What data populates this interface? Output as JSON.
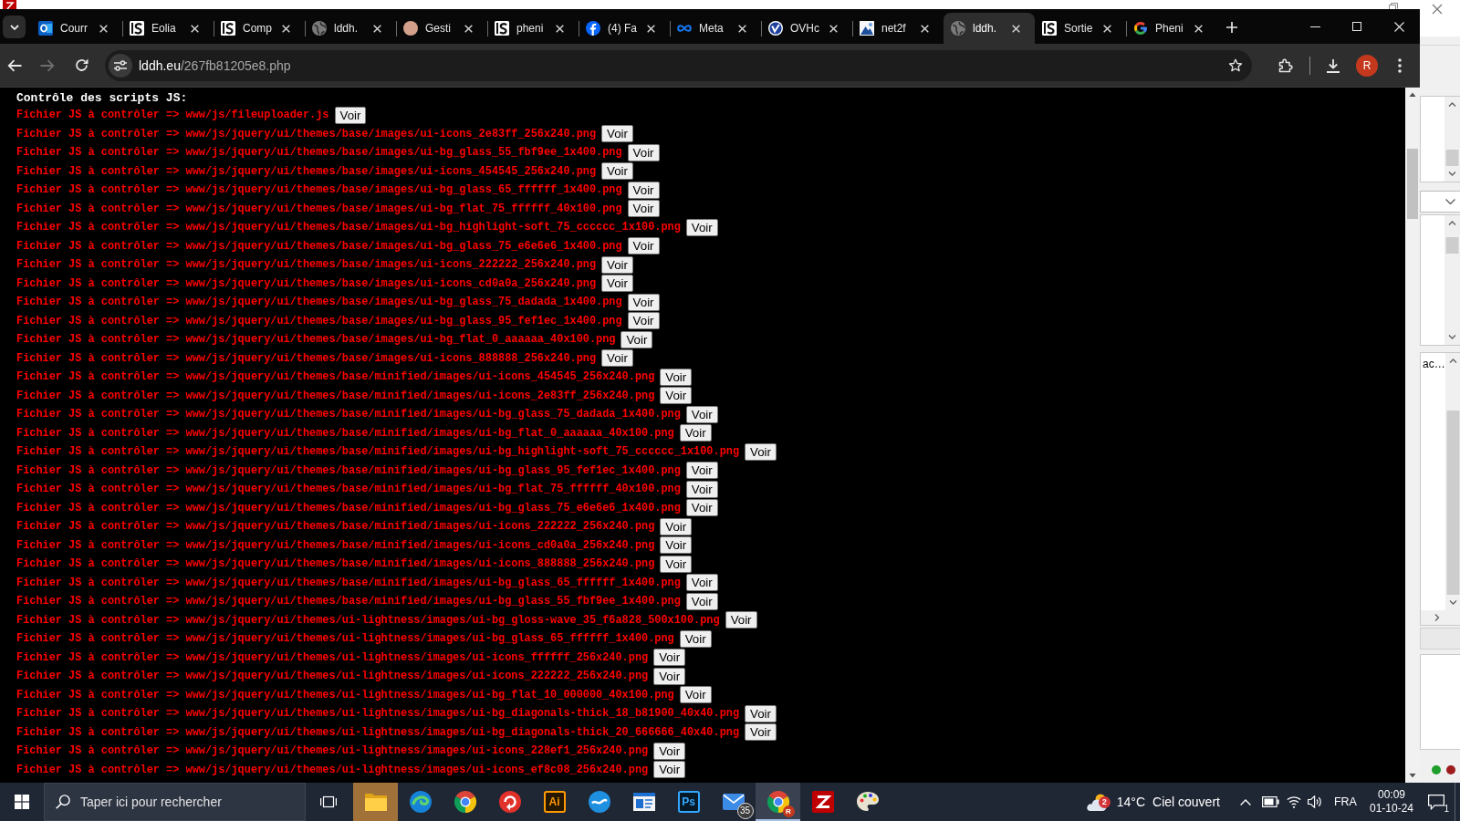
{
  "background_window": {
    "panel_text": "ac…",
    "status_lights": [
      {
        "color": "#1e9e2a"
      },
      {
        "color": "#9e1b1b"
      }
    ]
  },
  "browser": {
    "tabs": [
      {
        "title": "Courr",
        "kind": "mail",
        "selected": false
      },
      {
        "title": "Eolia",
        "kind": "logo",
        "selected": false
      },
      {
        "title": "Comp",
        "kind": "logo",
        "selected": false
      },
      {
        "title": "lddh.",
        "kind": "globe",
        "selected": false
      },
      {
        "title": "Gesti",
        "kind": "avatar",
        "selected": false
      },
      {
        "title": "pheni",
        "kind": "logo",
        "selected": false
      },
      {
        "title": "(4) Fa",
        "kind": "social",
        "selected": false
      },
      {
        "title": "Meta",
        "kind": "infinity",
        "selected": false
      },
      {
        "title": "OVHc",
        "kind": "check",
        "selected": false
      },
      {
        "title": "net2f",
        "kind": "picture",
        "selected": false
      },
      {
        "title": "lddh.",
        "kind": "globe",
        "selected": true
      },
      {
        "title": "Sortie",
        "kind": "logo",
        "selected": false
      },
      {
        "title": "Pheni",
        "kind": "ring",
        "selected": false
      }
    ],
    "navigation": {
      "back": {
        "disabled": false
      },
      "forward": {
        "disabled": true
      }
    },
    "address_bar": {
      "host": "lddh.eu",
      "path": "/267fb81205e8.php"
    },
    "profile_initial": "R",
    "page": {
      "heading": "Contrôle des scripts JS:",
      "rows": [
        {
          "text": "Fichier JS à contrôler => www/js/fileuploader.js",
          "button": "Voir"
        },
        {
          "text": "Fichier JS à contrôler => www/js/jquery/ui/themes/base/images/ui-icons_2e83ff_256x240.png",
          "button": "Voir"
        },
        {
          "text": "Fichier JS à contrôler => www/js/jquery/ui/themes/base/images/ui-bg_glass_55_fbf9ee_1x400.png",
          "button": "Voir"
        },
        {
          "text": "Fichier JS à contrôler => www/js/jquery/ui/themes/base/images/ui-icons_454545_256x240.png",
          "button": "Voir"
        },
        {
          "text": "Fichier JS à contrôler => www/js/jquery/ui/themes/base/images/ui-bg_glass_65_ffffff_1x400.png",
          "button": "Voir"
        },
        {
          "text": "Fichier JS à contrôler => www/js/jquery/ui/themes/base/images/ui-bg_flat_75_ffffff_40x100.png",
          "button": "Voir"
        },
        {
          "text": "Fichier JS à contrôler => www/js/jquery/ui/themes/base/images/ui-bg_highlight-soft_75_cccccc_1x100.png",
          "button": "Voir"
        },
        {
          "text": "Fichier JS à contrôler => www/js/jquery/ui/themes/base/images/ui-bg_glass_75_e6e6e6_1x400.png",
          "button": "Voir"
        },
        {
          "text": "Fichier JS à contrôler => www/js/jquery/ui/themes/base/images/ui-icons_222222_256x240.png",
          "button": "Voir"
        },
        {
          "text": "Fichier JS à contrôler => www/js/jquery/ui/themes/base/images/ui-icons_cd0a0a_256x240.png",
          "button": "Voir"
        },
        {
          "text": "Fichier JS à contrôler => www/js/jquery/ui/themes/base/images/ui-bg_glass_75_dadada_1x400.png",
          "button": "Voir"
        },
        {
          "text": "Fichier JS à contrôler => www/js/jquery/ui/themes/base/images/ui-bg_glass_95_fef1ec_1x400.png",
          "button": "Voir"
        },
        {
          "text": "Fichier JS à contrôler => www/js/jquery/ui/themes/base/images/ui-bg_flat_0_aaaaaa_40x100.png",
          "button": "Voir"
        },
        {
          "text": "Fichier JS à contrôler => www/js/jquery/ui/themes/base/images/ui-icons_888888_256x240.png",
          "button": "Voir"
        },
        {
          "text": "Fichier JS à contrôler => www/js/jquery/ui/themes/base/minified/images/ui-icons_454545_256x240.png",
          "button": "Voir"
        },
        {
          "text": "Fichier JS à contrôler => www/js/jquery/ui/themes/base/minified/images/ui-icons_2e83ff_256x240.png",
          "button": "Voir"
        },
        {
          "text": "Fichier JS à contrôler => www/js/jquery/ui/themes/base/minified/images/ui-bg_glass_75_dadada_1x400.png",
          "button": "Voir"
        },
        {
          "text": "Fichier JS à contrôler => www/js/jquery/ui/themes/base/minified/images/ui-bg_flat_0_aaaaaa_40x100.png",
          "button": "Voir"
        },
        {
          "text": "Fichier JS à contrôler => www/js/jquery/ui/themes/base/minified/images/ui-bg_highlight-soft_75_cccccc_1x100.png",
          "button": "Voir"
        },
        {
          "text": "Fichier JS à contrôler => www/js/jquery/ui/themes/base/minified/images/ui-bg_glass_95_fef1ec_1x400.png",
          "button": "Voir"
        },
        {
          "text": "Fichier JS à contrôler => www/js/jquery/ui/themes/base/minified/images/ui-bg_flat_75_ffffff_40x100.png",
          "button": "Voir"
        },
        {
          "text": "Fichier JS à contrôler => www/js/jquery/ui/themes/base/minified/images/ui-bg_glass_75_e6e6e6_1x400.png",
          "button": "Voir"
        },
        {
          "text": "Fichier JS à contrôler => www/js/jquery/ui/themes/base/minified/images/ui-icons_222222_256x240.png",
          "button": "Voir"
        },
        {
          "text": "Fichier JS à contrôler => www/js/jquery/ui/themes/base/minified/images/ui-icons_cd0a0a_256x240.png",
          "button": "Voir"
        },
        {
          "text": "Fichier JS à contrôler => www/js/jquery/ui/themes/base/minified/images/ui-icons_888888_256x240.png",
          "button": "Voir"
        },
        {
          "text": "Fichier JS à contrôler => www/js/jquery/ui/themes/base/minified/images/ui-bg_glass_65_ffffff_1x400.png",
          "button": "Voir"
        },
        {
          "text": "Fichier JS à contrôler => www/js/jquery/ui/themes/base/minified/images/ui-bg_glass_55_fbf9ee_1x400.png",
          "button": "Voir"
        },
        {
          "text": "Fichier JS à contrôler => www/js/jquery/ui/themes/ui-lightness/images/ui-bg_gloss-wave_35_f6a828_500x100.png",
          "button": "Voir"
        },
        {
          "text": "Fichier JS à contrôler => www/js/jquery/ui/themes/ui-lightness/images/ui-bg_glass_65_ffffff_1x400.png",
          "button": "Voir"
        },
        {
          "text": "Fichier JS à contrôler => www/js/jquery/ui/themes/ui-lightness/images/ui-icons_ffffff_256x240.png",
          "button": "Voir"
        },
        {
          "text": "Fichier JS à contrôler => www/js/jquery/ui/themes/ui-lightness/images/ui-icons_222222_256x240.png",
          "button": "Voir"
        },
        {
          "text": "Fichier JS à contrôler => www/js/jquery/ui/themes/ui-lightness/images/ui-bg_flat_10_000000_40x100.png",
          "button": "Voir"
        },
        {
          "text": "Fichier JS à contrôler => www/js/jquery/ui/themes/ui-lightness/images/ui-bg_diagonals-thick_18_b81900_40x40.png",
          "button": "Voir"
        },
        {
          "text": "Fichier JS à contrôler => www/js/jquery/ui/themes/ui-lightness/images/ui-bg_diagonals-thick_20_666666_40x40.png",
          "button": "Voir"
        },
        {
          "text": "Fichier JS à contrôler => www/js/jquery/ui/themes/ui-lightness/images/ui-icons_228ef1_256x240.png",
          "button": "Voir"
        },
        {
          "text": "Fichier JS à contrôler => www/js/jquery/ui/themes/ui-lightness/images/ui-icons_ef8c08_256x240.png",
          "button": "Voir"
        }
      ]
    }
  },
  "taskbar": {
    "search": {
      "placeholder": "Taper ici pour rechercher"
    },
    "apps": [
      {
        "kind": "folder",
        "selected": false,
        "attention": true
      },
      {
        "kind": "wave",
        "selected": false,
        "attention": false
      },
      {
        "kind": "browser",
        "selected": false,
        "attention": false
      },
      {
        "kind": "swirl",
        "selected": false,
        "attention": false
      },
      {
        "kind": "tile",
        "label": "Ai",
        "color": "#ff9a00",
        "selected": false,
        "attention": false
      },
      {
        "kind": "bubble",
        "selected": false,
        "attention": false
      },
      {
        "kind": "news",
        "selected": false,
        "attention": false
      },
      {
        "kind": "tile",
        "label": "Ps",
        "color": "#31a8ff",
        "selected": false,
        "attention": false
      },
      {
        "kind": "mail",
        "badge": "35",
        "selected": false,
        "attention": false
      },
      {
        "kind": "browser",
        "badge": "R",
        "selected": true,
        "attention": false
      },
      {
        "kind": "zigzag",
        "selected": false,
        "attention": false
      },
      {
        "kind": "palette",
        "selected": false,
        "attention": false
      }
    ],
    "weather": {
      "badge": "2",
      "temperature": "14°C",
      "condition": "Ciel couvert"
    },
    "language": "FRA",
    "time": "00:09",
    "date": "01-10-24",
    "notifications": "1"
  }
}
